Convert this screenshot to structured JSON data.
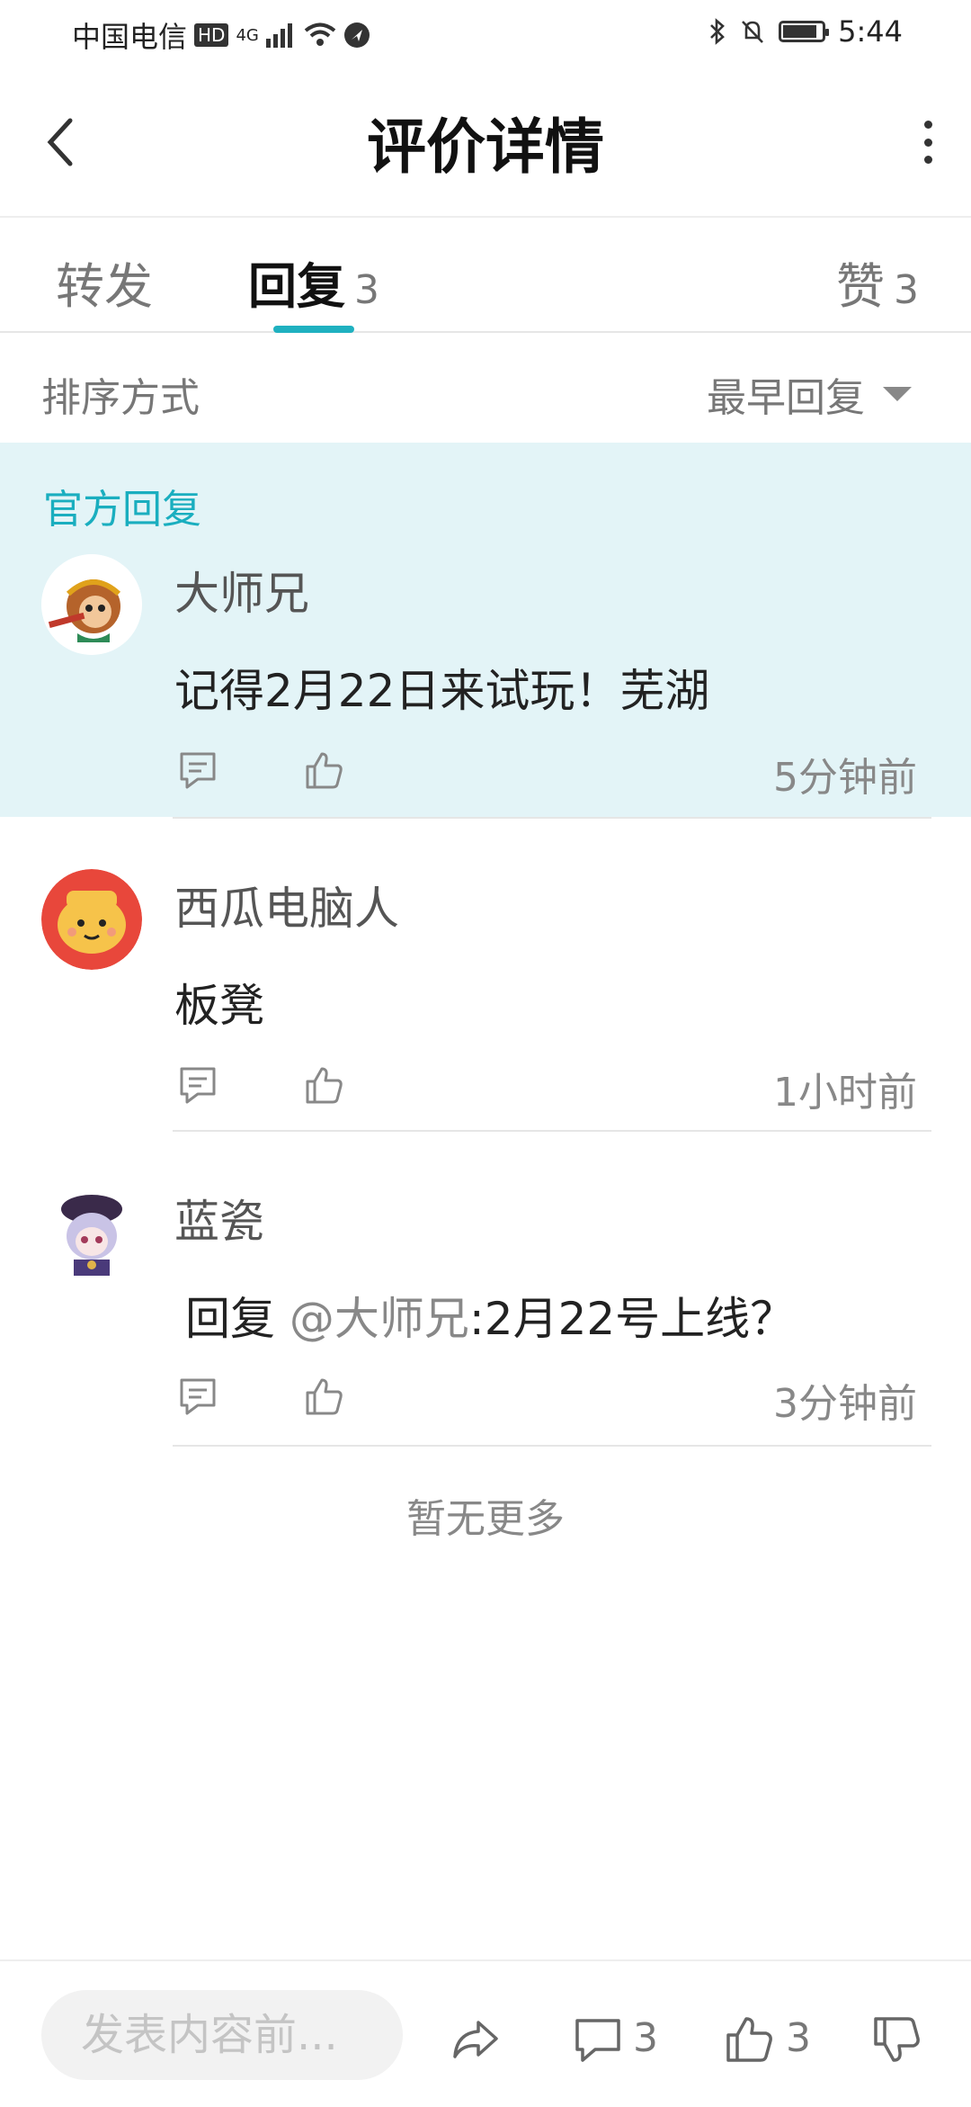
{
  "status_bar": {
    "carrier": "中国电信",
    "hd": "HD",
    "network": "4G",
    "time": "5:44"
  },
  "header": {
    "title": "评价详情"
  },
  "tabs": {
    "forward_label": "转发",
    "reply_label": "回复",
    "reply_count": "3",
    "like_label": "赞",
    "like_count": "3"
  },
  "sort": {
    "label": "排序方式",
    "value": "最早回复"
  },
  "official": {
    "label": "官方回复"
  },
  "replies": [
    {
      "username": "大师兄",
      "content": "记得2月22日来试玩！芜湖",
      "time": "5分钟前",
      "avatar_icon": "monkey-king-avatar"
    },
    {
      "username": "西瓜电脑人",
      "content": "板凳",
      "time": "1小时前",
      "avatar_icon": "yellow-cartoon-avatar"
    },
    {
      "username": "蓝瓷",
      "reply_prefix": "回复",
      "mention": "@大师兄",
      "content": ":2月22号上线？",
      "time": "3分钟前",
      "avatar_icon": "anime-girl-avatar"
    }
  ],
  "footer": {
    "no_more": "暂无更多"
  },
  "bottom_bar": {
    "input_placeholder": "发表内容前...",
    "comment_count": "3",
    "like_count": "3"
  },
  "colors": {
    "accent": "#1aaebf",
    "official_bg": "#e3f4f7"
  }
}
